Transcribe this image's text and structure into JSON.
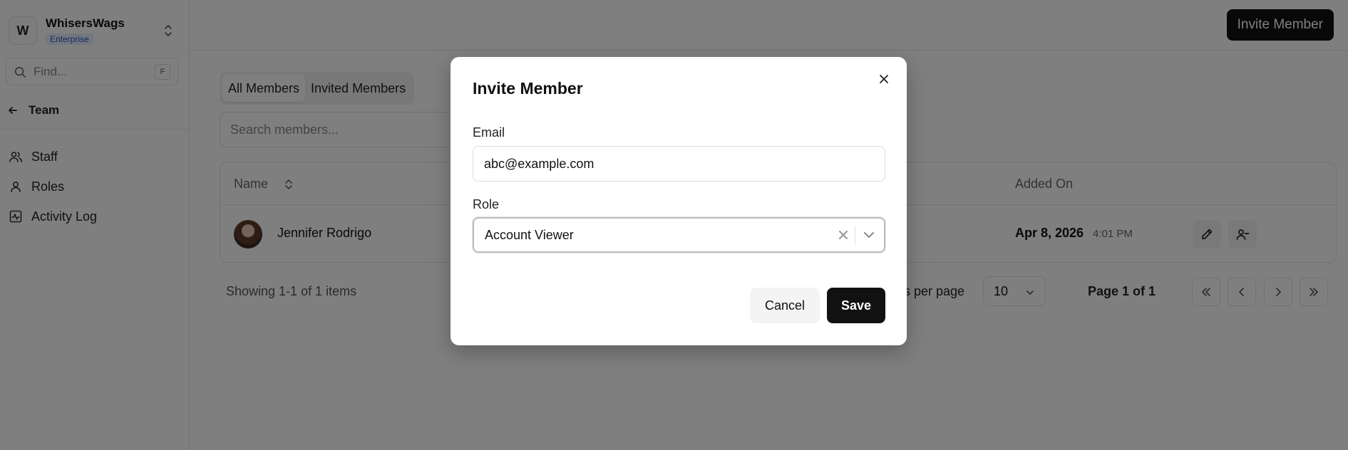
{
  "org": {
    "initial": "W",
    "name": "WhisersWags",
    "plan": "Enterprise"
  },
  "sidebar": {
    "find_placeholder": "Find...",
    "find_shortcut": "F",
    "back_label": "Team",
    "items": [
      {
        "label": "Staff",
        "icon": "users-icon"
      },
      {
        "label": "Roles",
        "icon": "user-icon"
      },
      {
        "label": "Activity Log",
        "icon": "activity-icon"
      }
    ]
  },
  "header": {
    "invite_button": "Invite Member"
  },
  "main": {
    "tabs": [
      {
        "label": "All Members",
        "active": true
      },
      {
        "label": "Invited Members",
        "active": false
      }
    ],
    "search_placeholder": "Search members...",
    "table": {
      "columns": [
        "Name",
        "Added On"
      ],
      "rows": [
        {
          "name": "Jennifer Rodrigo",
          "added_date": "Apr 8, 2026",
          "added_time": "4:01 PM"
        }
      ]
    },
    "pagination": {
      "showing": "Showing 1-1 of 1 items",
      "per_page_label": "ms per page",
      "per_page_value": "10",
      "page_info": "Page 1 of 1"
    }
  },
  "modal": {
    "title": "Invite Member",
    "email_label": "Email",
    "email_value": "abc@example.com",
    "role_label": "Role",
    "role_value": "Account Viewer",
    "cancel_label": "Cancel",
    "save_label": "Save"
  },
  "colors": {
    "primary_button": "#111111",
    "overlay": "rgba(0,0,0,0.5)",
    "badge_text": "#2b59c3",
    "badge_bg": "#e6efff"
  }
}
